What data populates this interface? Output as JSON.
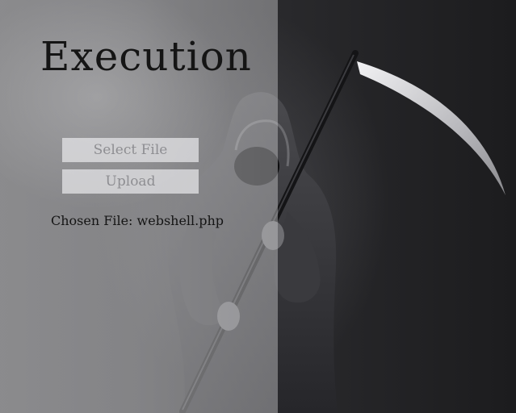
{
  "title": "Execution",
  "buttons": {
    "select_file": "Select File",
    "upload": "Upload"
  },
  "chosen_file": {
    "text": "Chosen File: webshell.php"
  },
  "background": {
    "image_subject": "grim-reaper-with-scythe"
  }
}
